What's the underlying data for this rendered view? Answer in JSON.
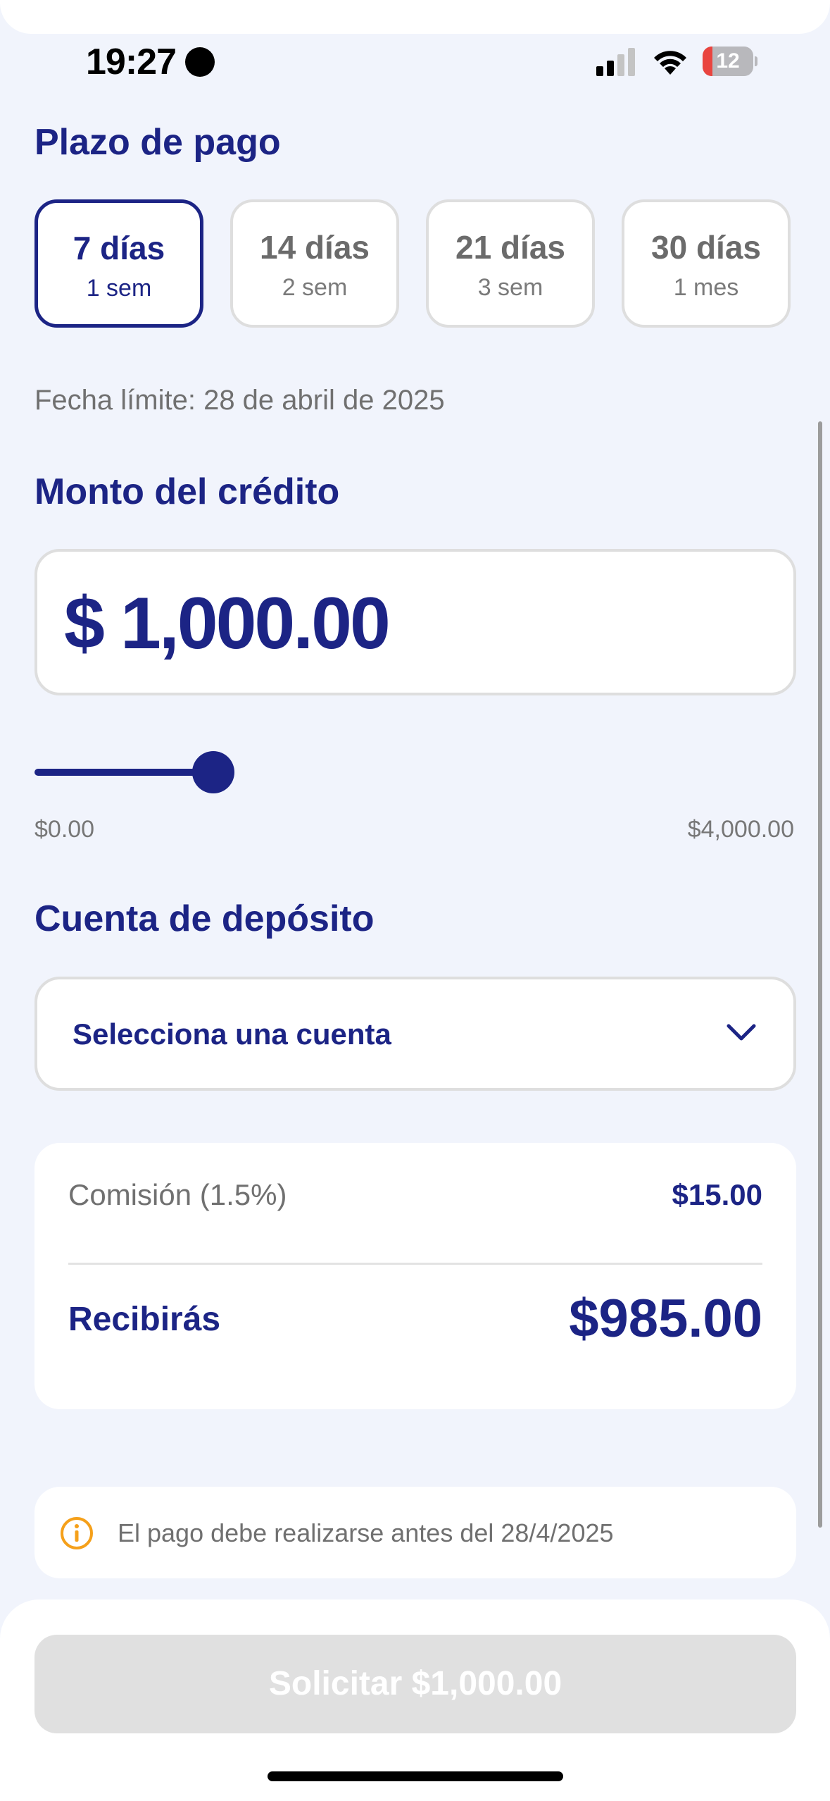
{
  "status_bar": {
    "time": "19:27",
    "battery_level": "12"
  },
  "term_section": {
    "title": "Plazo de pago",
    "options": [
      {
        "label": "7 días",
        "sub": "1 sem",
        "selected": true
      },
      {
        "label": "14 días",
        "sub": "2 sem",
        "selected": false
      },
      {
        "label": "21 días",
        "sub": "3 sem",
        "selected": false
      },
      {
        "label": "30 días",
        "sub": "1 mes",
        "selected": false
      }
    ],
    "due_date": "Fecha límite: 28 de abril de 2025"
  },
  "amount_section": {
    "title": "Monto del crédito",
    "currency": "$",
    "amount": "1,000.00",
    "slider_min": "$0.00",
    "slider_max": "$4,000.00",
    "slider_value_fraction": 0.25
  },
  "account_section": {
    "title": "Cuenta de depósito",
    "placeholder": "Selecciona una cuenta"
  },
  "summary": {
    "fee_label": "Comisión (1.5%)",
    "fee_value": "$15.00",
    "receive_label": "Recibirás",
    "receive_value": "$985.00"
  },
  "notice": {
    "text": "El pago debe realizarse antes del 28/4/2025"
  },
  "cta": {
    "label": "Solicitar $1,000.00"
  },
  "colors": {
    "accent": "#1c2485",
    "background": "#f1f4fc",
    "warning": "#f5a01a",
    "disabled": "#e0e0e0"
  }
}
